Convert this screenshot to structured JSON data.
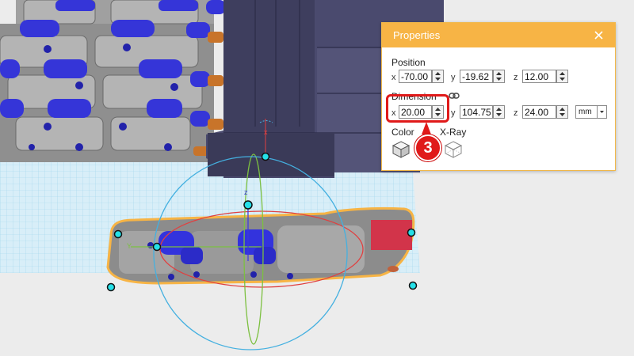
{
  "properties_panel": {
    "title": "Properties",
    "position_label": "Position",
    "dimension_label": "Dimension",
    "color_label": "Color",
    "xray_label": "X-Ray",
    "axes": {
      "x": "x",
      "y": "y",
      "z": "z"
    },
    "position": {
      "x": "-70.00",
      "y": "-19.62",
      "z": "12.00"
    },
    "dimension": {
      "x": "20.00",
      "y": "104.75",
      "z": "24.00"
    },
    "unit": "mm"
  },
  "annotation": {
    "step_number": "3"
  },
  "colors": {
    "header": "#f7b445",
    "highlight": "#e01a1a",
    "part_gray": "#9a9a9a",
    "hinge_blue": "#3333dd",
    "grid": "#aadcf2",
    "gizmo_ring": "#44b0e0",
    "dark_part": "#4a4a6e",
    "red_block": "#d2344a",
    "selection_outline": "#f7b445"
  }
}
